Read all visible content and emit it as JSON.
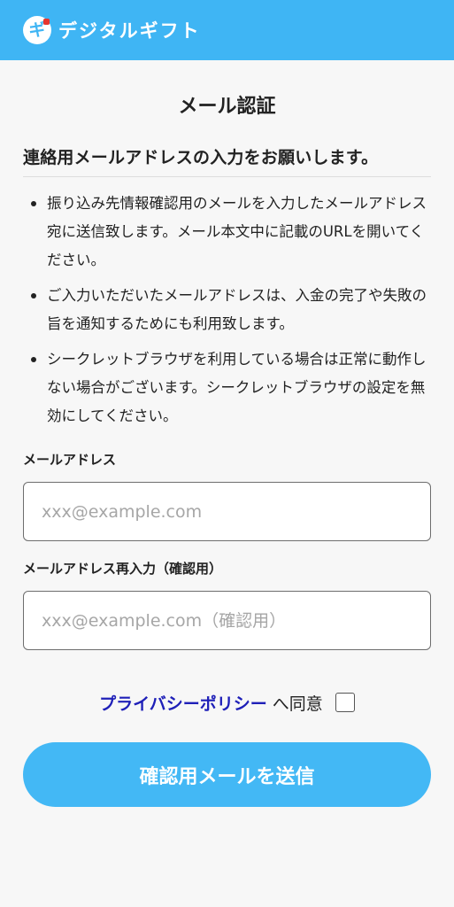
{
  "header": {
    "logo_glyph": "ギ",
    "logo_text": "デジタルギフト",
    "brand_color": "#3fb5f4"
  },
  "page": {
    "title": "メール認証",
    "lead": "連絡用メールアドレスの入力をお願いします。"
  },
  "notes": [
    "振り込み先情報確認用のメールを入力したメールアドレス宛に送信致します。メール本文中に記載のURLを開いてください。",
    "ご入力いただいたメールアドレスは、入金の完了や失敗の旨を通知するためにも利用致します。",
    "シークレットブラウザを利用している場合は正常に動作しない場合がございます。シークレットブラウザの設定を無効にしてください。"
  ],
  "form": {
    "email_label": "メールアドレス",
    "email_placeholder": "xxx@example.com",
    "email_value": "",
    "confirm_label": "メールアドレス再入力（確認用）",
    "confirm_placeholder": "xxx@example.com（確認用）",
    "confirm_value": "",
    "policy_link": "プライバシーポリシー",
    "agree_text": "へ同意",
    "agree_checked": false,
    "submit_label": "確認用メールを送信",
    "button_color": "#43b8f5",
    "link_color": "#1f20b8"
  }
}
